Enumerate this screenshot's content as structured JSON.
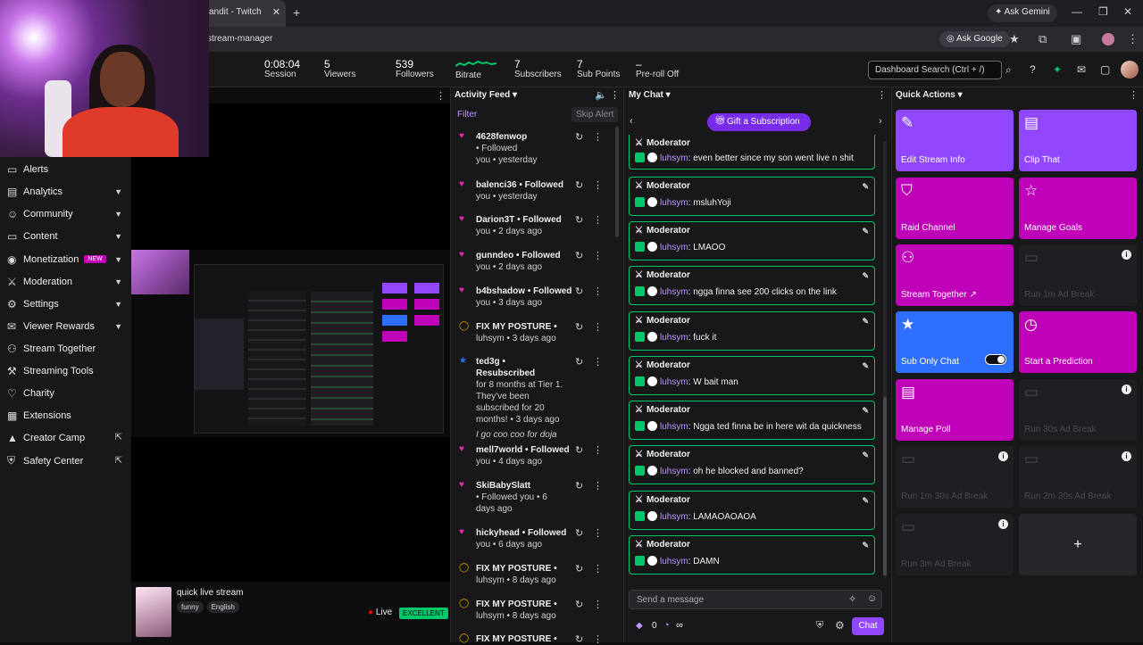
{
  "browser": {
    "tab_title": "andit - Twitch",
    "ask_gemini": "Ask Gemini",
    "url": "stream-manager",
    "ask_google": "Ask Google"
  },
  "header": {
    "stats": [
      {
        "value": "0:08:04",
        "label": "Session"
      },
      {
        "value": "5",
        "label": "Viewers"
      },
      {
        "value": "539",
        "label": "Followers"
      },
      {
        "value": "",
        "label": "Bitrate"
      },
      {
        "value": "7",
        "label": "Subscribers"
      },
      {
        "value": "7",
        "label": "Sub Points"
      },
      {
        "value": "–",
        "label": "Pre-roll Off"
      }
    ],
    "search_placeholder": "Dashboard Search (Ctrl + /)"
  },
  "sidebar": {
    "items": [
      {
        "label": "Alerts",
        "icon": "bell-icon"
      },
      {
        "label": "Analytics",
        "icon": "chart-icon"
      },
      {
        "label": "Community",
        "icon": "people-icon"
      },
      {
        "label": "Content",
        "icon": "content-icon"
      },
      {
        "label": "Monetization",
        "icon": "coin-icon",
        "badge": "NEW"
      },
      {
        "label": "Moderation",
        "icon": "sword-icon"
      },
      {
        "label": "Settings",
        "icon": "gear-icon"
      },
      {
        "label": "Viewer Rewards",
        "icon": "gift-icon"
      },
      {
        "label": "Stream Together",
        "icon": "stream-together-icon"
      },
      {
        "label": "Streaming Tools",
        "icon": "tools-icon"
      },
      {
        "label": "Charity",
        "icon": "heart-hand-icon"
      },
      {
        "label": "Extensions",
        "icon": "puzzle-icon"
      },
      {
        "label": "Creator Camp",
        "icon": "camp-icon"
      },
      {
        "label": "Safety Center",
        "icon": "shield-icon"
      }
    ]
  },
  "stream_info": {
    "title": "quick live stream",
    "tags": [
      "funny",
      "English"
    ],
    "live": "Live",
    "quality": "EXCELLENT"
  },
  "activity": {
    "title": "Activity Feed",
    "filter": "Filter",
    "skip_alert": "Skip Alert",
    "items": [
      {
        "name": "4628fenwop",
        "action": "• Followed",
        "meta": "you • yesterday",
        "type": "follow"
      },
      {
        "name": "balenci36",
        "action": "• Followed",
        "meta": "you • yesterday",
        "type": "follow"
      },
      {
        "name": "Darion3T",
        "action": "• Followed",
        "meta": "you • 2 days ago",
        "type": "follow"
      },
      {
        "name": "gunndeo",
        "action": "• Followed",
        "meta": "you • 2 days ago",
        "type": "follow"
      },
      {
        "name": "b4bshadow",
        "action": "• Followed",
        "meta": "you • 3 days ago",
        "type": "follow"
      },
      {
        "name": "FIX MY POSTURE",
        "action": "•",
        "meta": "luhsym • 3 days ago",
        "type": "reward"
      },
      {
        "name": "ted3g",
        "action": "• Resubscribed",
        "meta": "for 8 months at Tier 1. They've been subscribed for 20 months! • 3 days ago",
        "note": "I go coo coo for doja",
        "type": "sub"
      },
      {
        "name": "mell7world",
        "action": "• Followed",
        "meta": "you • 4 days ago",
        "type": "follow"
      },
      {
        "name": "SkiBabySlatt",
        "action": "• Followed you • 6",
        "meta": "days ago",
        "type": "follow"
      },
      {
        "name": "hickyhead",
        "action": "• Followed",
        "meta": "you • 6 days ago",
        "type": "follow"
      },
      {
        "name": "FIX MY POSTURE",
        "action": "•",
        "meta": "luhsym • 8 days ago",
        "type": "reward"
      },
      {
        "name": "FIX MY POSTURE",
        "action": "•",
        "meta": "luhsym • 8 days ago",
        "type": "reward"
      },
      {
        "name": "FIX MY POSTURE",
        "action": "•",
        "meta": "",
        "type": "reward"
      }
    ]
  },
  "chat": {
    "title": "My Chat",
    "gift": "Gift a Subscription",
    "role": "Moderator",
    "user": "luhsym",
    "messages": [
      ": even better since my son went live n shit",
      ": msluhYoji",
      ": LMAOO",
      ": ngga finna see 200 clicks on the link",
      ": fuck it",
      ": W bait man",
      ": Ngga ted finna be in here wit da quickness",
      ": oh he blocked and banned?",
      ": LAMAOAOAOA",
      ": DAMN"
    ],
    "send_placeholder": "Send a message",
    "points": "0",
    "chat_button": "Chat"
  },
  "quick_actions": {
    "title": "Quick Actions",
    "tiles": [
      {
        "label": "Edit Stream Info",
        "color": "#9147ff",
        "icon": "pencil-icon"
      },
      {
        "label": "Clip That",
        "color": "#9147ff",
        "icon": "clapper-icon"
      },
      {
        "label": "Raid Channel",
        "color": "#bf00b8",
        "icon": "raid-icon"
      },
      {
        "label": "Manage Goals",
        "color": "#bf00b8",
        "icon": "star-icon"
      },
      {
        "label": "Stream Together ↗",
        "color": "#bf00b8",
        "icon": "add-user-icon"
      },
      {
        "label": "Run 1m Ad Break",
        "disabled": true,
        "icon": "ad-icon"
      },
      {
        "label": "Sub Only Chat",
        "color": "#2f6fff",
        "icon": "star-icon"
      },
      {
        "label": "Start a Prediction",
        "color": "#bf00b8",
        "icon": "prediction-icon"
      },
      {
        "label": "Manage Poll",
        "color": "#bf00b8",
        "icon": "poll-icon"
      },
      {
        "label": "Run 30s Ad Break",
        "disabled": true,
        "icon": "ad-icon"
      },
      {
        "label": "Run 1m 30s Ad Break",
        "disabled": true,
        "icon": "ad-icon"
      },
      {
        "label": "Run 2m 30s Ad Break",
        "disabled": true,
        "icon": "ad-icon"
      },
      {
        "label": "Run 3m Ad Break",
        "disabled": true,
        "icon": "ad-icon"
      }
    ],
    "add": "+"
  }
}
